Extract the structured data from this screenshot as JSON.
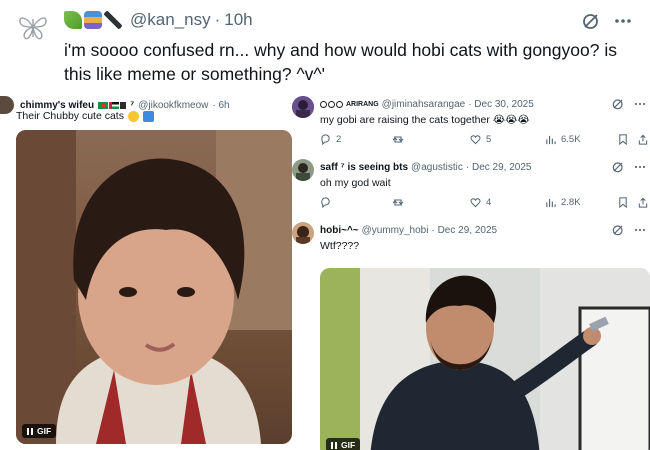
{
  "main": {
    "handle": "@kan_nsy",
    "dot": "·",
    "time": "10h",
    "text": "i'm soooo confused rn... why and how would hobi cats with gongyoo? is this like meme or something? ^v^'",
    "emoji_icons": [
      "herb-emoji",
      "books-emoji",
      "pen-emoji"
    ]
  },
  "left_card": {
    "name": "chimmy's wifeu",
    "badges": "⁷",
    "handle": "@jikookfkmeow",
    "time": "· 6h",
    "text": "Their Chubby cute cats",
    "gif_label": "GIF"
  },
  "replies": [
    {
      "name_prefix": "ARIRANG",
      "handle": "@jiminahsarangae",
      "time": "· Dec 30, 2025",
      "text": "my gobi are raising the cats together",
      "emoji": "😭😭😭",
      "metrics": {
        "replies": "2",
        "reposts": "",
        "likes": "5",
        "views": "6.5K"
      }
    },
    {
      "name": "saff ⁷ is seeing bts",
      "handle": "@agustistic",
      "time": "· Dec 29, 2025",
      "text": "oh my god wait",
      "metrics": {
        "replies": "",
        "reposts": "",
        "likes": "4",
        "views": "2.8K"
      }
    },
    {
      "name": "hobi~^~",
      "handle": "@yummy_hobi",
      "time": "· Dec 29, 2025",
      "text": "Wtf????",
      "gif_label": "GIF"
    }
  ],
  "colors": {
    "text": "#0f1419",
    "muted": "#536471",
    "accent": "#1d9bf0"
  }
}
